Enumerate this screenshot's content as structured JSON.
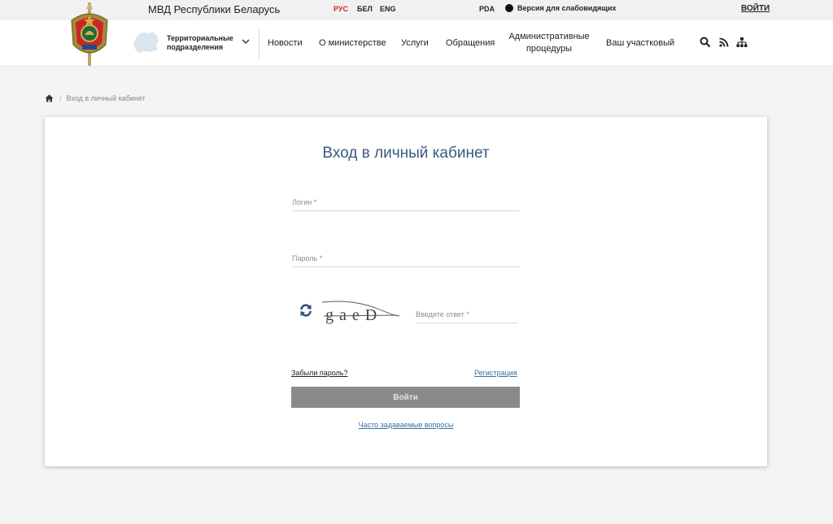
{
  "topbar": {
    "site_name": "МВД Республики Беларусь",
    "languages": [
      "РУС",
      "БЕЛ",
      "ENG"
    ],
    "active_language": "РУС",
    "pda": "PDA",
    "low_vision": "Версия для слабовидящих",
    "login": "ВОЙТИ"
  },
  "header": {
    "territorial": "Территориальные подразделения",
    "nav": [
      "Новости",
      "О министерстве",
      "Услуги",
      "Обращения",
      "Административные процедуры",
      "Ваш участковый"
    ],
    "icons": [
      "search-icon",
      "rss-icon",
      "sitemap-icon"
    ]
  },
  "breadcrumb": {
    "current": "Вход в личный кабинет"
  },
  "login_form": {
    "title": "Вход в личный кабинет",
    "login_placeholder": "Логин *",
    "password_placeholder": "Пароль *",
    "captcha_text": "gaeD",
    "captcha_placeholder": "Введите ответ *",
    "forgot_password": "Забыли пароль?",
    "register": "Регистрация",
    "submit": "Войти",
    "faq": "Часто задаваемые вопросы"
  },
  "colors": {
    "accent_red": "#d9261c",
    "title_blue": "#3b5a82",
    "link_blue": "#3b6ea5",
    "button_grey": "#8a8a8a"
  }
}
